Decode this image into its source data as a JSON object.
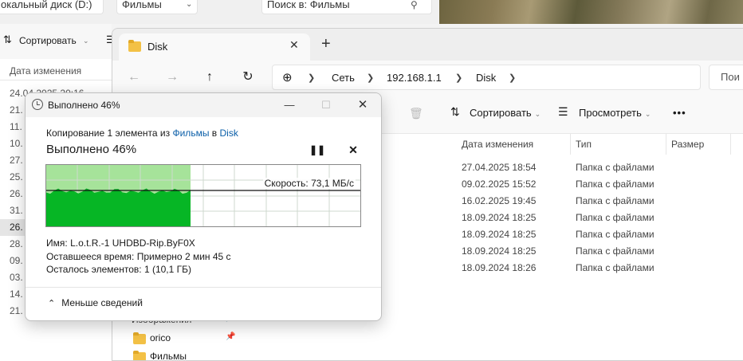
{
  "background_window": {
    "drive_box": "окальный диск (D:)",
    "folder_box": "Фильмы",
    "search_box": "Поиск в: Фильмы",
    "sort_label": "Сортировать",
    "column_date": "Дата изменения",
    "rows": [
      "24.04.2025 20:16",
      "21.",
      "11.",
      "10.",
      "27.",
      "25.",
      "26.",
      "31.",
      "26.",
      "28.",
      "09.",
      "03.",
      "14.",
      "21."
    ]
  },
  "disk_window": {
    "tab_title": "Disk",
    "breadcrumbs": [
      "Сеть",
      "192.168.1.1",
      "Disk"
    ],
    "search_placeholder": "Пои",
    "toolbar": {
      "sort_label": "Сортировать",
      "view_label": "Просмотреть",
      "more_label": "•••"
    },
    "columns": {
      "date": "Дата изменения",
      "type": "Тип",
      "size": "Размер"
    },
    "files": [
      {
        "date": "27.04.2025 18:54",
        "type": "Папка с файлами"
      },
      {
        "date": "09.02.2025 15:52",
        "type": "Папка с файлами"
      },
      {
        "date": "16.02.2025 19:45",
        "type": "Папка с файлами"
      },
      {
        "date": "18.09.2024 18:25",
        "type": "Папка с файлами"
      },
      {
        "date": "18.09.2024 18:25",
        "type": "Папка с файлами"
      },
      {
        "date": "18.09.2024 18:25",
        "type": "Папка с файлами"
      },
      {
        "date": "18.09.2024 18:26",
        "type": "Папка с файлами"
      }
    ],
    "nav_items": [
      "Изображения",
      "orico",
      "Фильмы"
    ]
  },
  "copy_dialog": {
    "title": "Выполнено 46%",
    "source_prefix": "Копирование 1 элемента из",
    "source_folder": "Фильмы",
    "source_middle": "в",
    "dest_folder": "Disk",
    "progress_text": "Выполнено 46%",
    "progress_percent": 46,
    "speed_text": "Скорость: 73,1 МБ/с",
    "name_label": "Имя:",
    "name_value": "L.o.t.R.-1 UHDBD-Rip.ByF0X",
    "time_label": "Оставшееся время:",
    "time_value": "Примерно 2 мин 45 с",
    "items_label": "Осталось элементов:",
    "items_value": "1 (10,1 ГБ)",
    "less_details": "Меньше сведений",
    "colors": {
      "done_light": "#a6e39a",
      "fill_green": "#06b625",
      "accent_link": "#0a5ea8"
    }
  }
}
